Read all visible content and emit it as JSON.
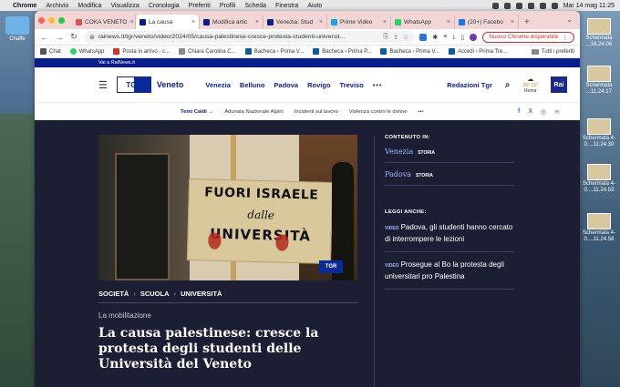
{
  "menubar": {
    "app": "Chrome",
    "items": [
      "Archivio",
      "Modifica",
      "Visualizza",
      "Cronologia",
      "Preferiti",
      "Profili",
      "Scheda",
      "Finestra",
      "Aiuto"
    ],
    "clock": "Mar 14 mag  11:25"
  },
  "desktop": {
    "folder_label": "Chaffe",
    "screenshots": [
      "Schermata ...16.24.06",
      "Schermata ...11.24.17",
      "Schermata 4-0....11.24.30",
      "Schermata 4-0....11.24.53",
      "Schermata 4-0....11.24.58"
    ]
  },
  "tabs": [
    {
      "label": "COKA VENETO",
      "color": "#d9534f",
      "active": false
    },
    {
      "label": "La causa",
      "color": "#0a1d8c",
      "active": true
    },
    {
      "label": "Modifica artic",
      "color": "#0a1d8c",
      "active": false
    },
    {
      "label": "Venezia: Stud",
      "color": "#0a1d8c",
      "active": false
    },
    {
      "label": "Prime Video",
      "color": "#1aa3e8",
      "active": false
    },
    {
      "label": "WhatsApp",
      "color": "#25d366",
      "active": false
    },
    {
      "label": "(20+) Facebo",
      "color": "#1877f2",
      "active": false
    }
  ],
  "address": {
    "url": "rainews.it/tgr/veneto/video/2024/05/causa-palestinese-cresce-protesta-studenti-universit...",
    "update_button": "Nuovo Chrome disponibile"
  },
  "bookmarks": [
    {
      "label": "Chat",
      "color": "#555"
    },
    {
      "label": "WhatsApp",
      "color": "#25d366"
    },
    {
      "label": "Posta in arrivo - c...",
      "color": "#d93025"
    },
    {
      "label": "Chiara Carolina C...",
      "color": "#888"
    },
    {
      "label": "Bacheca ‹ Prima V...",
      "color": "#0a5aa8"
    },
    {
      "label": "Bacheca ‹ Prima P...",
      "color": "#0a5aa8"
    },
    {
      "label": "Bacheca ‹ Prima V...",
      "color": "#0a5aa8"
    },
    {
      "label": "Accedi ‹ Prima Tre...",
      "color": "#0a5aa8"
    }
  ],
  "bookmarks_all": "Tutti i preferiti",
  "site": {
    "top_strip": "Vai a RaiNews.it",
    "logo_text": "TGR",
    "region": "Veneto",
    "nav": [
      "Venezia",
      "Belluno",
      "Padova",
      "Rovigo",
      "Treviso"
    ],
    "nav_more": "•••",
    "redazioni": "Redazioni Tgr",
    "weather_temp": "26° 15°",
    "weather_city": "Roma",
    "rai": "Rai",
    "topics_lead": "Temi Caldi",
    "topics": [
      "Adunata Nazionale Alpini",
      "Incidenti sul lavoro",
      "Violenza contro le donne"
    ],
    "social": [
      "f",
      "X",
      "◎",
      "≋"
    ]
  },
  "article": {
    "sign_line1": "FUORI ISRAELE",
    "sign_line2": "dalle",
    "sign_line3": "UNIVERSITÀ",
    "image_logo": "TGR",
    "breadcrumbs": [
      "SOCIETÀ",
      "SCUOLA",
      "UNIVERSITÀ"
    ],
    "kicker": "La mobilitazione",
    "headline": "La causa palestinese: cresce la protesta degli studenti delle Università del Veneto"
  },
  "sidebar": {
    "content_label": "CONTENUTO IN:",
    "content_items": [
      {
        "city": "Venezia",
        "tag": "STORIA"
      },
      {
        "city": "Padova",
        "tag": "STORIA"
      }
    ],
    "read_label": "LEGGI ANCHE:",
    "news": [
      {
        "tag": "VIDEO",
        "text": "Padova, gli studenti hanno cercato di interrompere le lezioni"
      },
      {
        "tag": "VIDEO",
        "text": "Prosegue al Bo la protesta degli universitari pro Palestina"
      }
    ]
  }
}
